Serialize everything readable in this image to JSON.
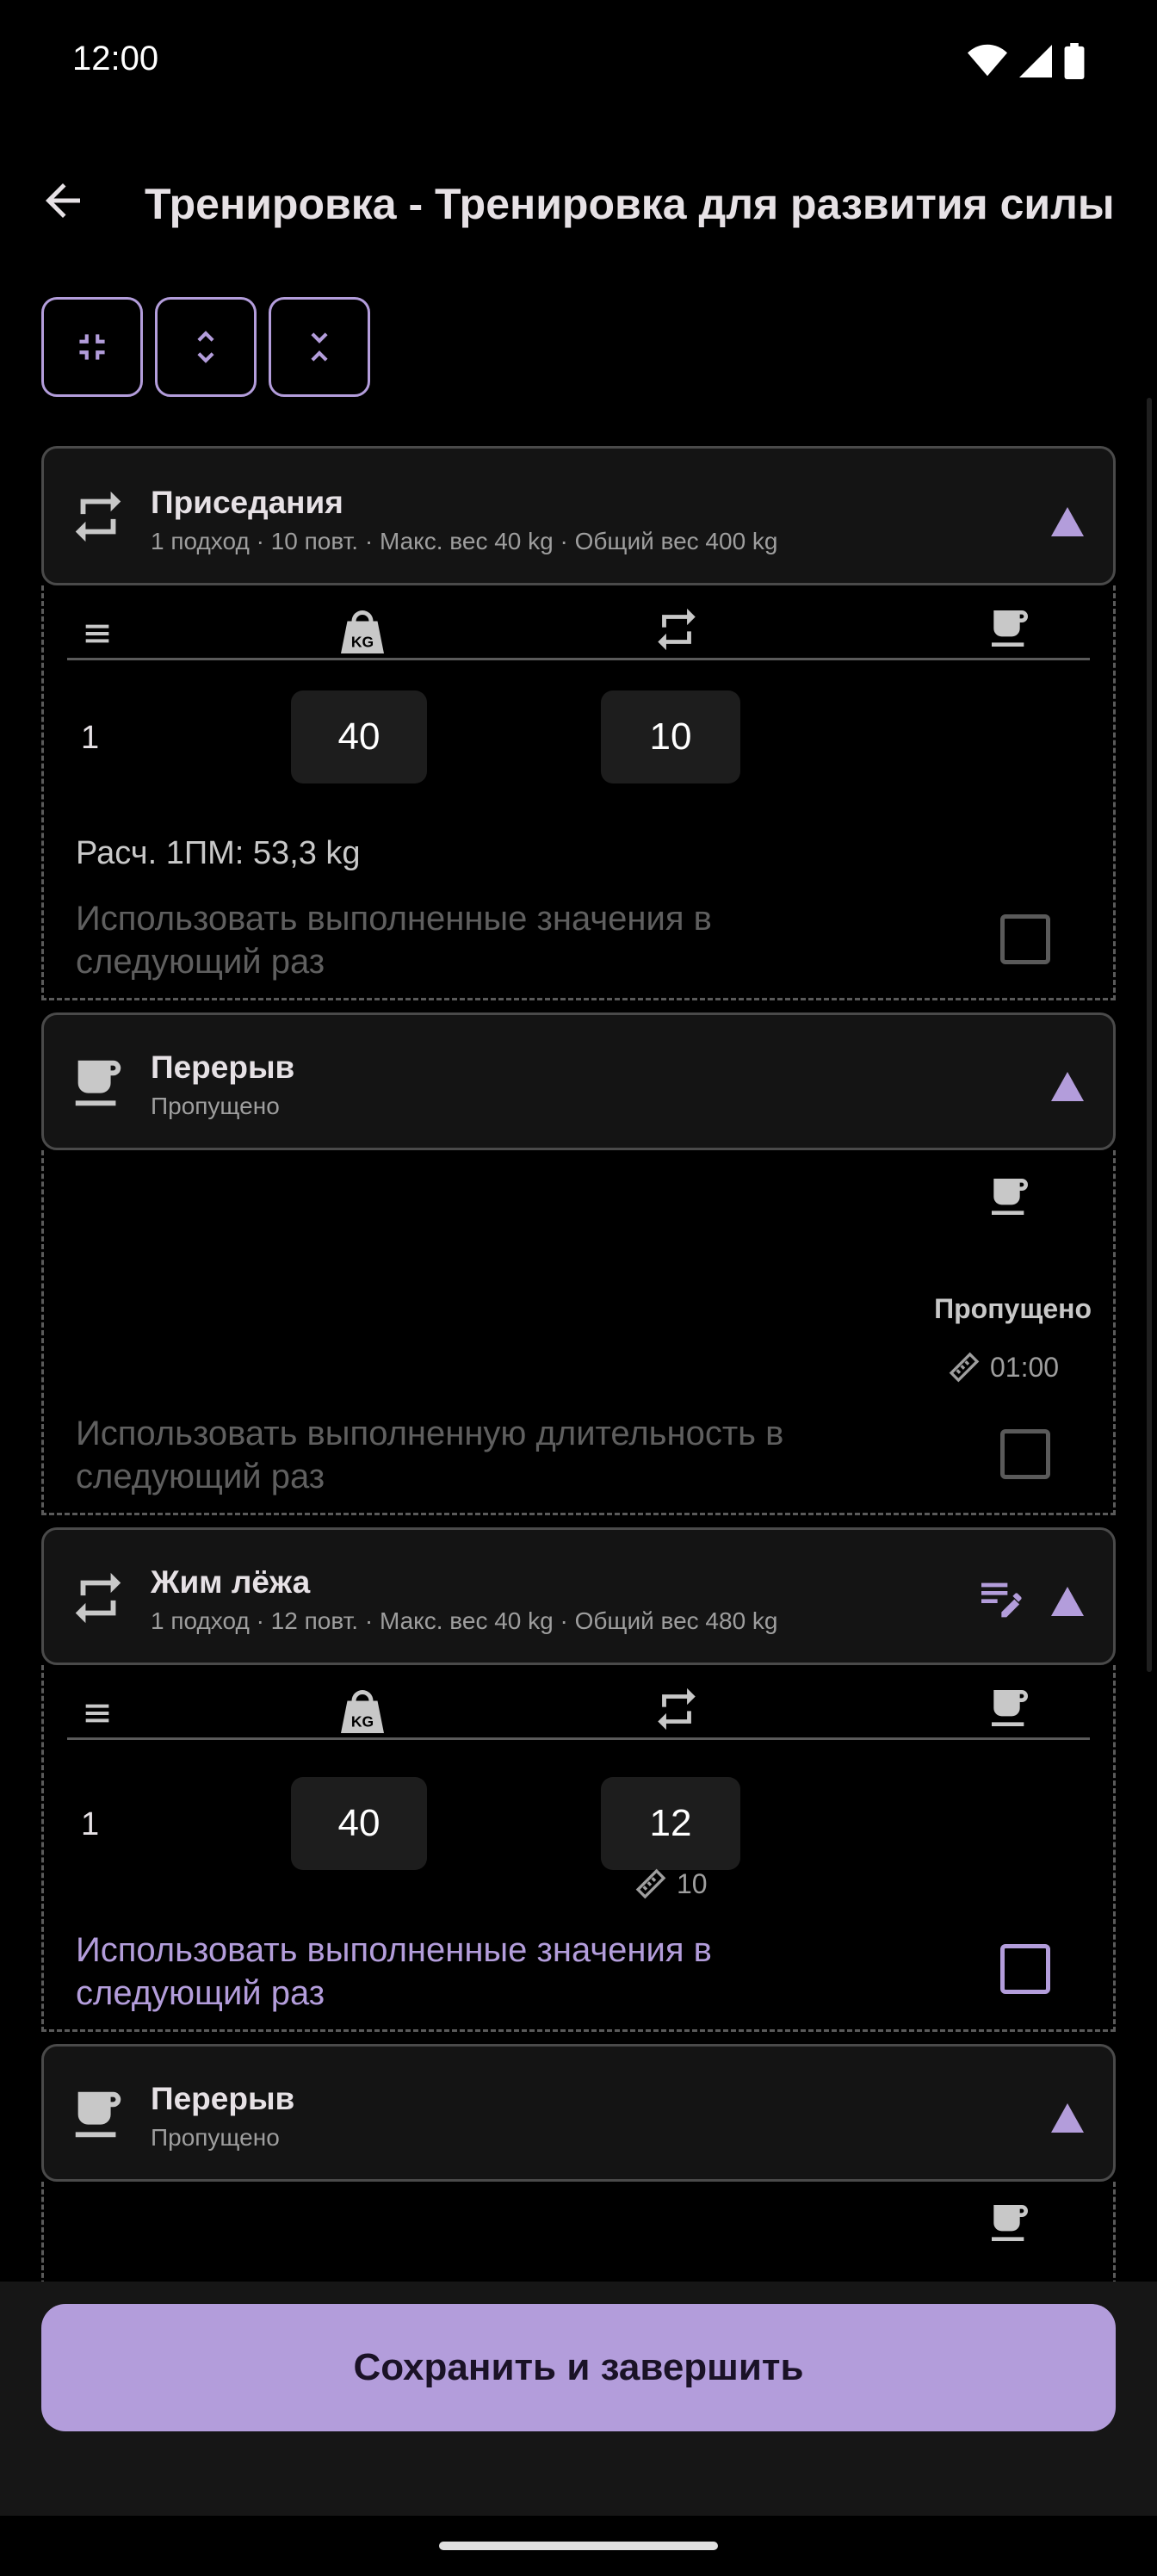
{
  "status_bar": {
    "time": "12:00"
  },
  "header": {
    "title": "Тренировка - Тренировка для развития силы"
  },
  "toolbar": {
    "buttons": [
      "collapse-all",
      "expand",
      "collapse"
    ]
  },
  "colors": {
    "accent": "#b39ddb",
    "background": "#000000",
    "card": "#141414",
    "button": "#b39ddb"
  },
  "table_icons": [
    "list-icon",
    "weight-kg-icon",
    "repeat-icon",
    "coffee-icon"
  ],
  "exercises": [
    {
      "name": "Приседания",
      "summary": "1 подход · 10 повт. · Макс. вес 40 kg · Общий вес 400 kg",
      "sets": [
        {
          "number": "1",
          "weight": "40",
          "reps": "10"
        }
      ],
      "one_rm": "Расч. 1ПМ: 53,3 kg",
      "use_values_label": "Использовать выполненные значения в следующий раз"
    },
    {
      "name": "Жим лёжа",
      "summary": "1 подход · 12 повт. · Макс. вес 40 kg · Общий вес 480 kg",
      "sets": [
        {
          "number": "1",
          "weight": "40",
          "reps": "12",
          "target_reps": "10"
        }
      ],
      "use_values_label": "Использовать выполненные значения в следующий раз"
    }
  ],
  "breaks": [
    {
      "name": "Перерыв",
      "status": "Пропущено",
      "detail_status": "Пропущено",
      "duration": "01:00",
      "use_duration_label": "Использовать выполненную длительность в следующий раз"
    },
    {
      "name": "Перерыв",
      "status": "Пропущено"
    }
  ],
  "footer": {
    "save_label": "Сохранить и завершить"
  }
}
